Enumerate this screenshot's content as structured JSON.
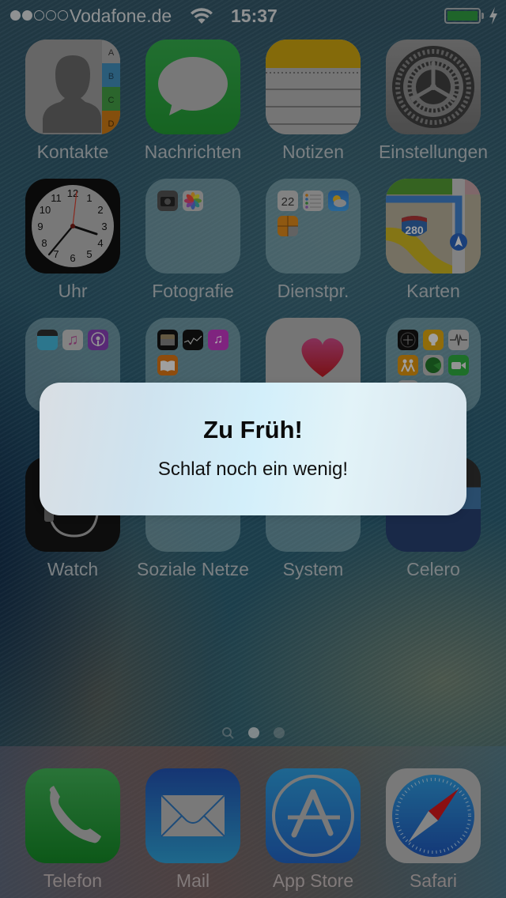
{
  "status_bar": {
    "signal_strength": 2,
    "signal_max": 5,
    "carrier": "Vodafone.de",
    "wifi_icon": "wifi-icon",
    "time": "15:37",
    "battery_level": 1.0,
    "battery_charging": true,
    "battery_color": "#2b8d3b"
  },
  "home_screen": {
    "apps": [
      {
        "label": "Kontakte",
        "type": "app",
        "icon": "contacts-icon"
      },
      {
        "label": "Nachrichten",
        "type": "app",
        "icon": "messages-icon"
      },
      {
        "label": "Notizen",
        "type": "app",
        "icon": "notes-icon"
      },
      {
        "label": "Einstellungen",
        "type": "app",
        "icon": "settings-gear-icon"
      },
      {
        "label": "Uhr",
        "type": "app",
        "icon": "clock-icon"
      },
      {
        "label": "Fotografie",
        "type": "folder",
        "contents": [
          "camera-icon",
          "photos-icon"
        ]
      },
      {
        "label": "Dienstpr.",
        "type": "folder",
        "contents": [
          "calendar-icon",
          "reminders-icon",
          "weather-icon",
          "calculator-icon"
        ]
      },
      {
        "label": "Karten",
        "type": "app",
        "icon": "maps-icon"
      },
      {
        "label": "",
        "type": "folder",
        "contents": [
          "videos-icon",
          "music-icon",
          "podcasts-icon"
        ]
      },
      {
        "label": "",
        "type": "folder",
        "contents": [
          "wallet-icon",
          "stocks-icon",
          "itunes-store-icon",
          "ibooks-icon"
        ]
      },
      {
        "label": "",
        "type": "app",
        "icon": "health-heart-icon"
      },
      {
        "label": "",
        "type": "folder",
        "contents": [
          "compass-icon",
          "tips-icon",
          "voice-memos-icon",
          "find-friends-icon",
          "find-iphone-icon",
          "facetime-icon"
        ]
      },
      {
        "label": "Watch",
        "type": "app",
        "icon": "watch-icon"
      },
      {
        "label": "Soziale Netze",
        "type": "folder",
        "contents": []
      },
      {
        "label": "System",
        "type": "folder",
        "contents": []
      },
      {
        "label": "Celero",
        "type": "app",
        "icon": "celero-icon"
      }
    ],
    "calendar_day": "22",
    "maps_route_number": "280",
    "page_indicator": {
      "pages": 2,
      "current": 1,
      "has_search_page": true
    }
  },
  "dock": {
    "apps": [
      {
        "label": "Telefon",
        "icon": "phone-icon"
      },
      {
        "label": "Mail",
        "icon": "mail-icon"
      },
      {
        "label": "App Store",
        "icon": "app-store-icon"
      },
      {
        "label": "Safari",
        "icon": "safari-compass-icon"
      }
    ]
  },
  "alert": {
    "title": "Zu Früh!",
    "message": "Schlaf noch ein wenig!"
  }
}
